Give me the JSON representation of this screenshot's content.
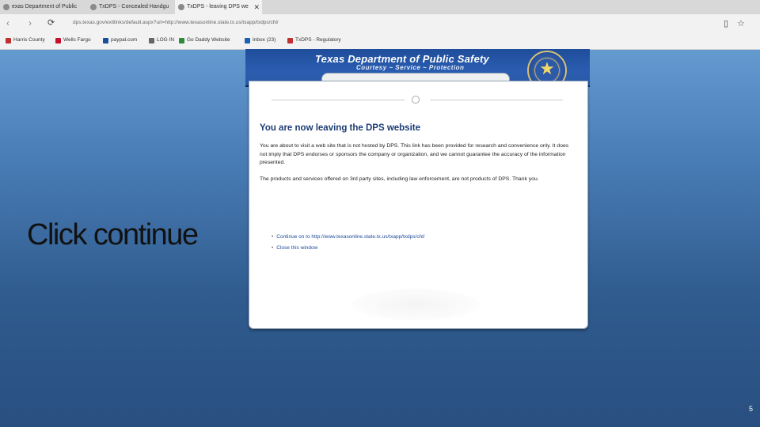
{
  "browser": {
    "tabs": [
      {
        "label": "exas Department of Public",
        "active": false
      },
      {
        "label": "TxDPS - Concealed Handgu",
        "active": false
      },
      {
        "label": "TxDPS - leaving DPS we",
        "active": true
      }
    ],
    "tab_close": "✕",
    "url": "dps.texas.gov/exitlinks/default.aspx?url=http://www.texasonline.state.tx.us/txapp/txdps/chl/",
    "nav": {
      "back": "‹",
      "forward": "›",
      "refresh": "⟳"
    },
    "right_icons": {
      "reading": "▯",
      "favorite": "☆"
    },
    "favorites": [
      {
        "label": "Harris County",
        "color": "#c03030"
      },
      {
        "label": "Wells Fargo",
        "color": "#c8102e"
      },
      {
        "label": "paypal.com",
        "color": "#1a4f9c"
      },
      {
        "label": "LOG IN",
        "color": "#666666"
      },
      {
        "label": "Go Daddy Website",
        "color": "#2f8a3b"
      },
      {
        "label": "Inbox (23)",
        "color": "#1b62b5"
      },
      {
        "label": "TxDPS - Regulatory",
        "color": "#c03030"
      }
    ]
  },
  "slide": {
    "title": "Click continue",
    "page_number": "5"
  },
  "dps_page": {
    "header_title": "Texas Department of Public Safety",
    "header_motto": "Courtesy  ~  Service  ~  Protection",
    "heading": "You are now leaving the DPS website",
    "paragraph1": "You are about to visit a web site that is not hosted by DPS. This link has been provided for research and convenience only. It does not imply that DPS endorses or sponsors the company or organization, and we cannot guarantee the accuracy of the information presented.",
    "paragraph2": "The products and services offered on 3rd party sites, including law enforcement, are not products of DPS. Thank you.",
    "continue_link": "Continue on to http://www.texasonline.state.tx.us/txapp/txdps/chl/",
    "close_link": "Close this window",
    "seal_star": "★"
  }
}
